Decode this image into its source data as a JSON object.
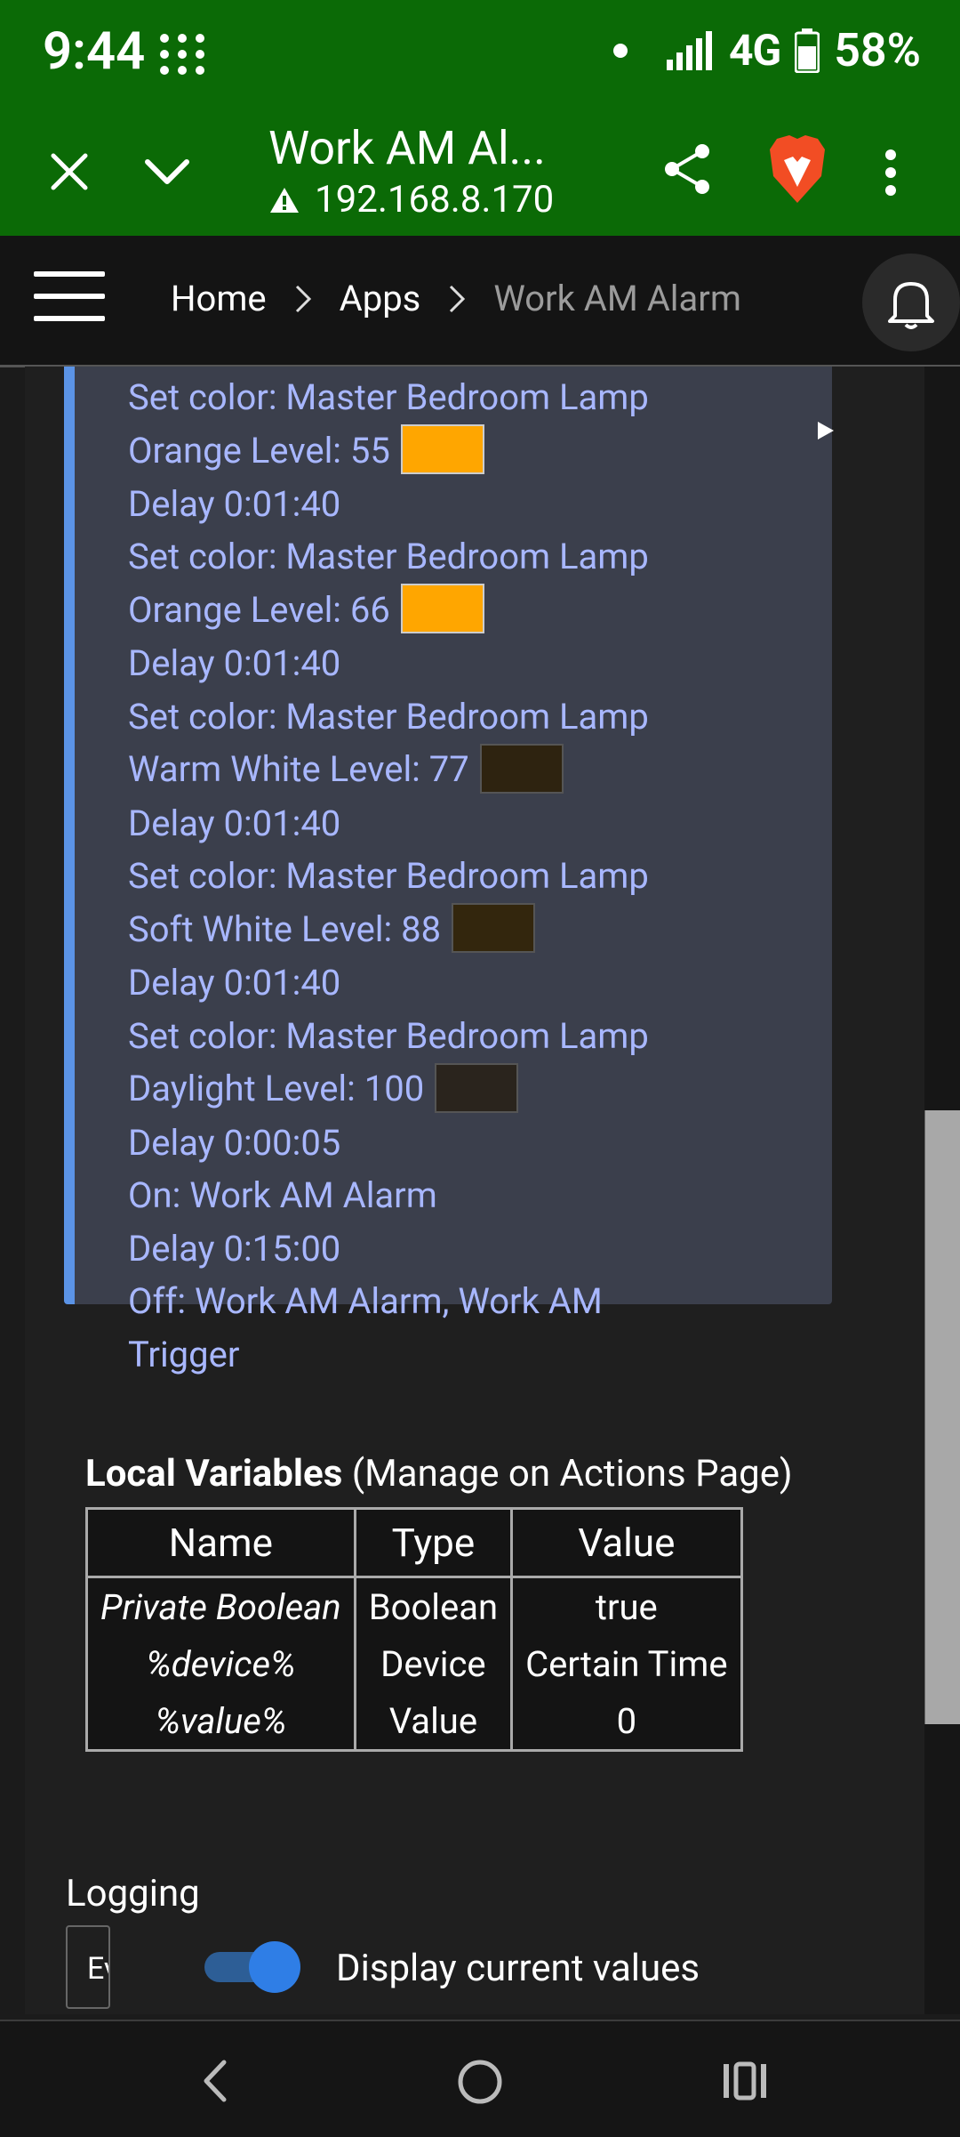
{
  "status_bar": {
    "time": "9:44",
    "network": "4G",
    "battery": "58%"
  },
  "browser_bar": {
    "title": "Work AM Al...",
    "url": "192.168.8.170"
  },
  "breadcrumb": {
    "items": [
      "Home",
      "Apps",
      "Work AM Alarm"
    ]
  },
  "actions": {
    "lines": [
      {
        "text": "Set color: Master Bedroom Lamp"
      },
      {
        "text": "Orange  Level: 55",
        "swatch": "#ffa600"
      },
      {
        "text": "Delay 0:01:40"
      },
      {
        "text": "Set color: Master Bedroom Lamp"
      },
      {
        "text": "Orange  Level: 66",
        "swatch": "#ffa600"
      },
      {
        "text": "Delay 0:01:40"
      },
      {
        "text": "Set color: Master Bedroom Lamp"
      },
      {
        "text": "Warm White  Level: 77",
        "swatch": "#2e2310"
      },
      {
        "text": "Delay 0:01:40"
      },
      {
        "text": "Set color: Master Bedroom Lamp"
      },
      {
        "text": "Soft White  Level: 88",
        "swatch": "#33260d"
      },
      {
        "text": "Delay 0:01:40"
      },
      {
        "text": "Set color: Master Bedroom Lamp"
      },
      {
        "text": "Daylight  Level: 100",
        "swatch": "#2a241d"
      },
      {
        "text": "Delay 0:00:05"
      },
      {
        "text": "On: Work AM Alarm"
      },
      {
        "text": "Delay 0:15:00"
      },
      {
        "text": "Off: Work AM Alarm, Work AM"
      },
      {
        "text": "Trigger"
      }
    ]
  },
  "local_variables": {
    "title": "Local Variables",
    "subtitle": "(Manage on Actions Page)",
    "headers": [
      "Name",
      "Type",
      "Value"
    ],
    "rows": [
      [
        "Private Boolean",
        "Boolean",
        "true"
      ],
      [
        "%device%",
        "Device",
        "Certain Time"
      ],
      [
        "%value%",
        "Value",
        "0"
      ]
    ]
  },
  "logging": {
    "label": "Logging",
    "select_value": "Even",
    "toggle_on": true,
    "toggle_label": "Display current values"
  },
  "colors": {
    "status_bar": "#0b6a06",
    "card_bg": "#3b3f4c",
    "card_accent": "#5b93e6",
    "action_text": "#a8b7ff"
  }
}
